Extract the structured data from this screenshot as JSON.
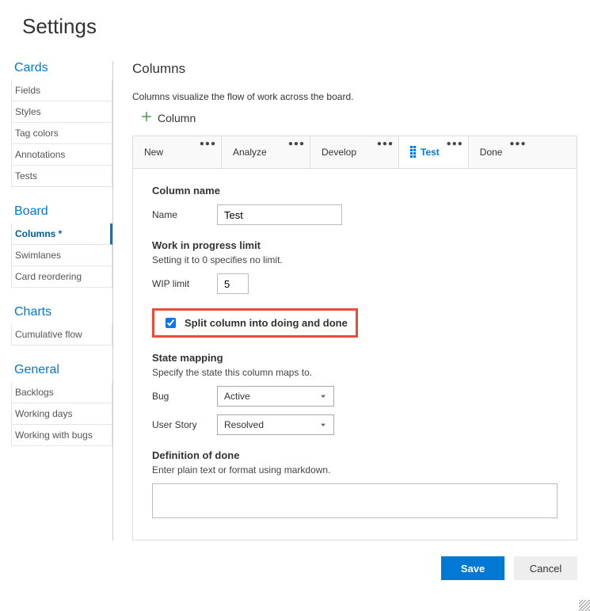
{
  "page_title": "Settings",
  "sidebar": {
    "sections": [
      {
        "heading": "Cards",
        "items": [
          "Fields",
          "Styles",
          "Tag colors",
          "Annotations",
          "Tests"
        ],
        "active": null
      },
      {
        "heading": "Board",
        "items": [
          "Columns *",
          "Swimlanes",
          "Card reordering"
        ],
        "active": 0
      },
      {
        "heading": "Charts",
        "items": [
          "Cumulative flow"
        ],
        "active": null
      },
      {
        "heading": "General",
        "items": [
          "Backlogs",
          "Working days",
          "Working with bugs"
        ],
        "active": null
      }
    ]
  },
  "main": {
    "title": "Columns",
    "intro": "Columns visualize the flow of work across the board.",
    "add_btn": "Column",
    "tabs": [
      "New",
      "Analyze",
      "Develop",
      "Test",
      "Done"
    ],
    "active_tab": 3,
    "column_name_heading": "Column name",
    "name_label": "Name",
    "name_value": "Test",
    "wip_heading": "Work in progress limit",
    "wip_sub": "Setting it to 0 specifies no limit.",
    "wip_label": "WIP limit",
    "wip_value": "5",
    "split_label": "Split column into doing and done",
    "split_checked": true,
    "state_heading": "State mapping",
    "state_sub": "Specify the state this column maps to.",
    "mappings": [
      {
        "label": "Bug",
        "value": "Active"
      },
      {
        "label": "User Story",
        "value": "Resolved"
      }
    ],
    "dod_heading": "Definition of done",
    "dod_sub": "Enter plain text or format using markdown."
  },
  "footer": {
    "save": "Save",
    "cancel": "Cancel"
  }
}
